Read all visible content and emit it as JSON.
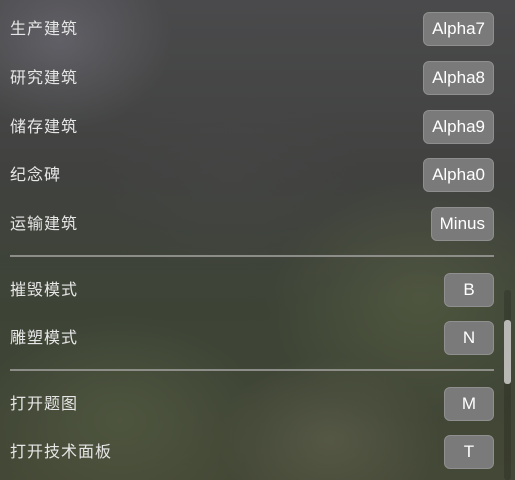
{
  "groups": [
    {
      "rows": [
        {
          "label": "生产建筑",
          "key": "Alpha7"
        },
        {
          "label": "研究建筑",
          "key": "Alpha8"
        },
        {
          "label": "储存建筑",
          "key": "Alpha9"
        },
        {
          "label": "纪念碑",
          "key": "Alpha0"
        },
        {
          "label": "运输建筑",
          "key": "Minus"
        }
      ]
    },
    {
      "rows": [
        {
          "label": "摧毁模式",
          "key": "B"
        },
        {
          "label": "雕塑模式",
          "key": "N"
        }
      ]
    },
    {
      "rows": [
        {
          "label": "打开题图",
          "key": "M"
        },
        {
          "label": "打开技术面板",
          "key": "T"
        }
      ]
    }
  ]
}
